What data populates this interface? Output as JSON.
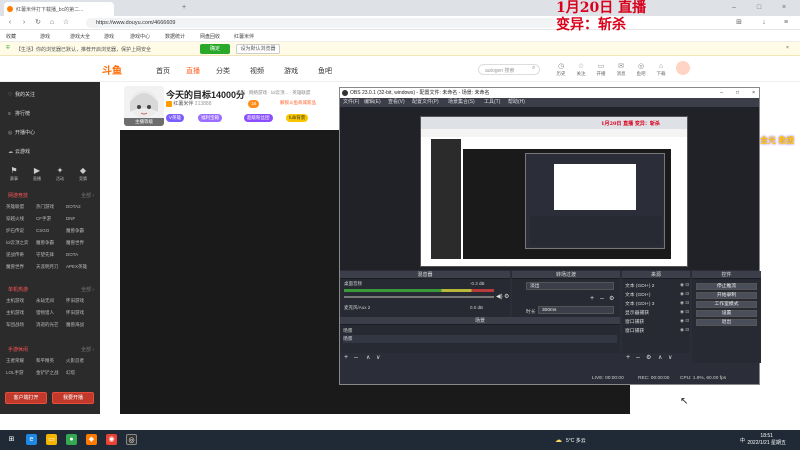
{
  "browser": {
    "tabs": [
      {
        "label": "红薯米伴打下载播_bc的第二..."
      },
      {
        "label": "　"
      }
    ],
    "url": "https://www.douyu.com/4666609",
    "bookmarks": [
      "收藏",
      "游戏",
      "游戏大全",
      "游戏",
      "游戏中心",
      "数据统计",
      "网盘回收",
      "红薯米伴"
    ],
    "infobar_text": "【生活】你的浏览器已默认，推荐开启浏览器，保护上网安全",
    "infobar_btn1": "确定",
    "infobar_btn2": "设为默认浏览器",
    "overlay": {
      "line1": "1月20日 直播",
      "line2": "变异：斩杀"
    }
  },
  "douyu": {
    "logo": "斗鱼",
    "nav": [
      "首页",
      "直播",
      "分类",
      "视频",
      "游戏",
      "鱼吧"
    ],
    "search_placeholder": "autogen 搜索",
    "header_icons": [
      {
        "glyph": "◷",
        "label": "历史"
      },
      {
        "glyph": "☆",
        "label": "关注"
      },
      {
        "glyph": "▭",
        "label": "开播"
      },
      {
        "glyph": "✉",
        "label": "消息"
      },
      {
        "glyph": "◎",
        "label": "鱼吧"
      },
      {
        "glyph": "⌂",
        "label": "下载"
      }
    ],
    "sidebar": {
      "main": [
        {
          "icon": "♡",
          "label": "我的关注"
        },
        {
          "icon": "≡",
          "label": "排行榜"
        },
        {
          "icon": "◎",
          "label": "开播中心"
        },
        {
          "icon": "☁",
          "label": "云游戏"
        }
      ],
      "quick_icons": [
        "赛事",
        "直播",
        "活动",
        "竞猜"
      ],
      "sections": [
        {
          "title": "网游竞技",
          "more": "全部 ›",
          "items": [
            "英雄联盟",
            "热门游戏",
            "DOTA2",
            "穿越火线",
            "CF手游",
            "DNF",
            "炉石传说",
            "CSGO",
            "魔兽争霸",
            "lol云顶之弈",
            "魔兽争霸",
            "魔兽世界",
            "逆战传奇",
            "守望先锋",
            "DOTA",
            "魔兽世界",
            "天涯明月刀",
            "APEX英雄"
          ]
        },
        {
          "title": "单机热游",
          "more": "全部 ›",
          "items": [
            "主机游戏",
            "永劫无间",
            "怀旧游戏",
            "主机游戏",
            "猎物猎人",
            "怀旧游戏",
            "军团战场",
            "消逝的光芒",
            "魔兽海战"
          ]
        },
        {
          "title": "手游休闲",
          "more": "全部 ›",
          "items": [
            "王者荣耀",
            "和平精英",
            "火影忍者",
            "LOL手游",
            "金铲铲之战",
            "幻塔"
          ]
        }
      ],
      "btn_left": "客户端打开",
      "btn_right": "我要开播"
    },
    "stream": {
      "title": "今天的目标14000分",
      "breadcrumb": "举报 · 网络游戏 · lol云顶... · 英雄联盟",
      "host_name": "红薯米伴",
      "host_id": "213888",
      "chips": [
        "V英雄",
        "福利宝箱",
        "超级粉丝团",
        "fulb背景"
      ],
      "promo": "解锁斗鱼商城新品",
      "avatar_label": "主播等级",
      "level": "18"
    }
  },
  "obs": {
    "title": "OBS 23.0.1 (32-bit, windows) - 配置文件: 未命名 - 场景: 未命名",
    "menu": [
      "文件(F)",
      "编辑(E)",
      "查看(V)",
      "配置文件(P)",
      "场景集合(S)",
      "工具(T)",
      "帮助(H)"
    ],
    "panels": {
      "mixer": "混音器",
      "transitions": "转场过渡",
      "scenes_title": "场景",
      "sources_title": "来源",
      "controls_title": "控件"
    },
    "mixer_rows": [
      {
        "name": "桌面音频",
        "db": "-0.3 dB"
      },
      {
        "name": "麦克风/Aux 2",
        "db": "0.0 dB"
      }
    ],
    "transition": {
      "type": "淡出",
      "duration_label": "时长",
      "duration": "300ms"
    },
    "scenes": [
      "场景",
      "场景"
    ],
    "sources": [
      "文本 (GDI+) 2",
      "文本 (GDI+)",
      "文本 (GDI+) 3",
      "显示器捕获",
      "窗口捕获",
      "窗口捕获"
    ],
    "controls": [
      "停止推流",
      "开始录制",
      "工作室模式",
      "设置",
      "退出"
    ],
    "status": {
      "live": "LIVE: 00:00:00",
      "rec": "REC: 00:00:00",
      "cpu": "CPU: 1.9%, 60.00 fps"
    }
  },
  "taskbar": {
    "weather": "5°C 多云",
    "time": "18:51",
    "date": "2022/1/21 星期五",
    "lang": "中"
  },
  "float_badge": "金光 救援",
  "preview_overlay": "1月20日 直播 变异：斩杀"
}
